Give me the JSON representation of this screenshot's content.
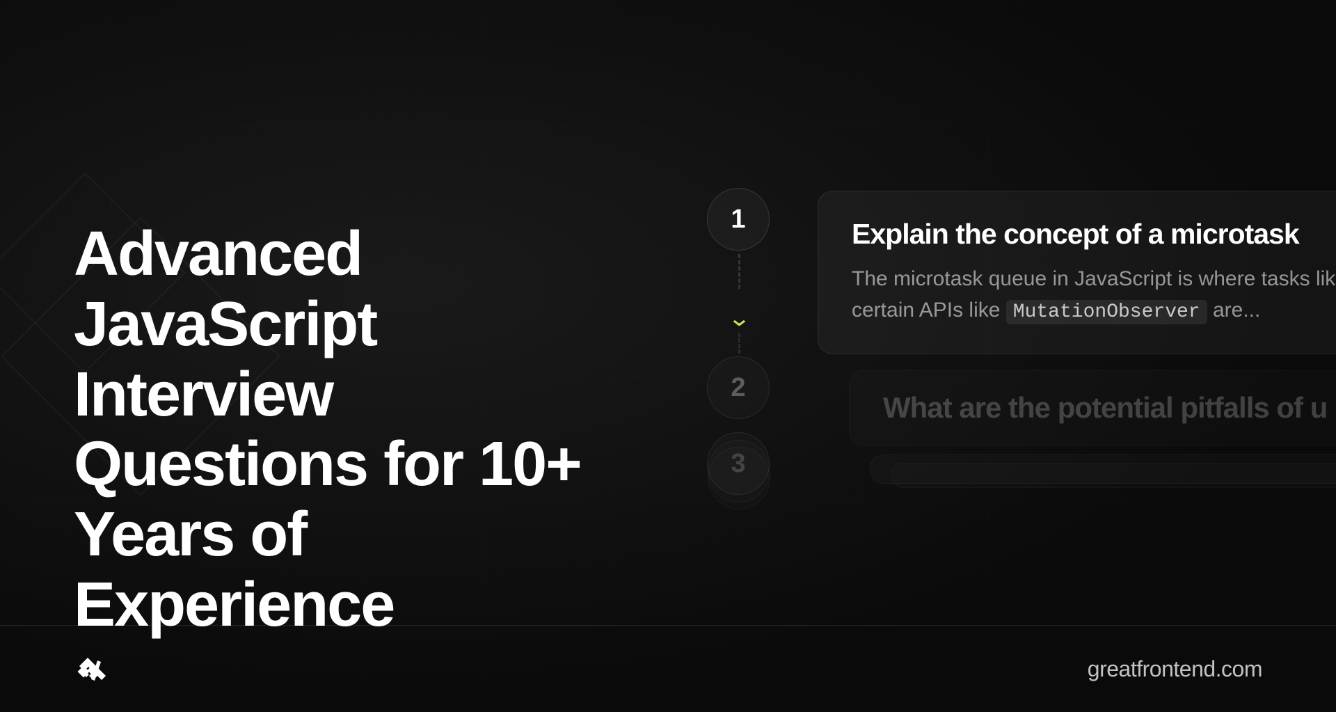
{
  "title": "Advanced JavaScript Interview Questions for 10+ Years of Experience",
  "steps": {
    "s1": "1",
    "s2": "2",
    "s3": "3"
  },
  "cards": {
    "card1": {
      "title": "Explain the concept of a microtask",
      "desc_part1": "The microtask queue in JavaScript is where tasks like",
      "desc_part2": "certain APIs like ",
      "code": "MutationObserver",
      "desc_part3": " are..."
    },
    "card2": {
      "title": "What are the potential pitfalls of u"
    }
  },
  "footer": {
    "url": "greatfrontend.com"
  }
}
